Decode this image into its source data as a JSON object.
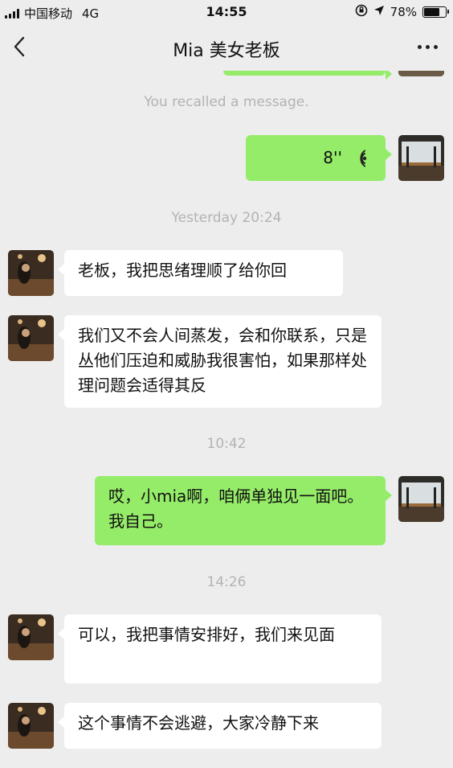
{
  "status_bar": {
    "carrier": "中国移动",
    "network": "4G",
    "time": "14:55",
    "battery_percent": "78%",
    "battery_level": 0.78
  },
  "header": {
    "title": "Mia 美女老板"
  },
  "messages": {
    "recall_notice": "You recalled a message.",
    "voice_duration": "8''",
    "time_1": "Yesterday 20:24",
    "msg_1": "老板，我把思绪理顺了给你回",
    "msg_2": "我们又不会人间蒸发，会和你联系，只是丛他们压迫和威胁我很害怕，如果那样处理问题会适得其反",
    "time_2": "10:42",
    "msg_3": "哎，小mia啊，咱俩单独见一面吧。我自己。",
    "time_3": "14:26",
    "msg_4": "可以，我把事情安排好，我们来见面",
    "msg_5": "这个事情不会逃避，大家冷静下来"
  },
  "colors": {
    "background": "#ededed",
    "outgoing_bubble": "#95ec69",
    "incoming_bubble": "#ffffff",
    "system_text": "#b3b3b3"
  }
}
